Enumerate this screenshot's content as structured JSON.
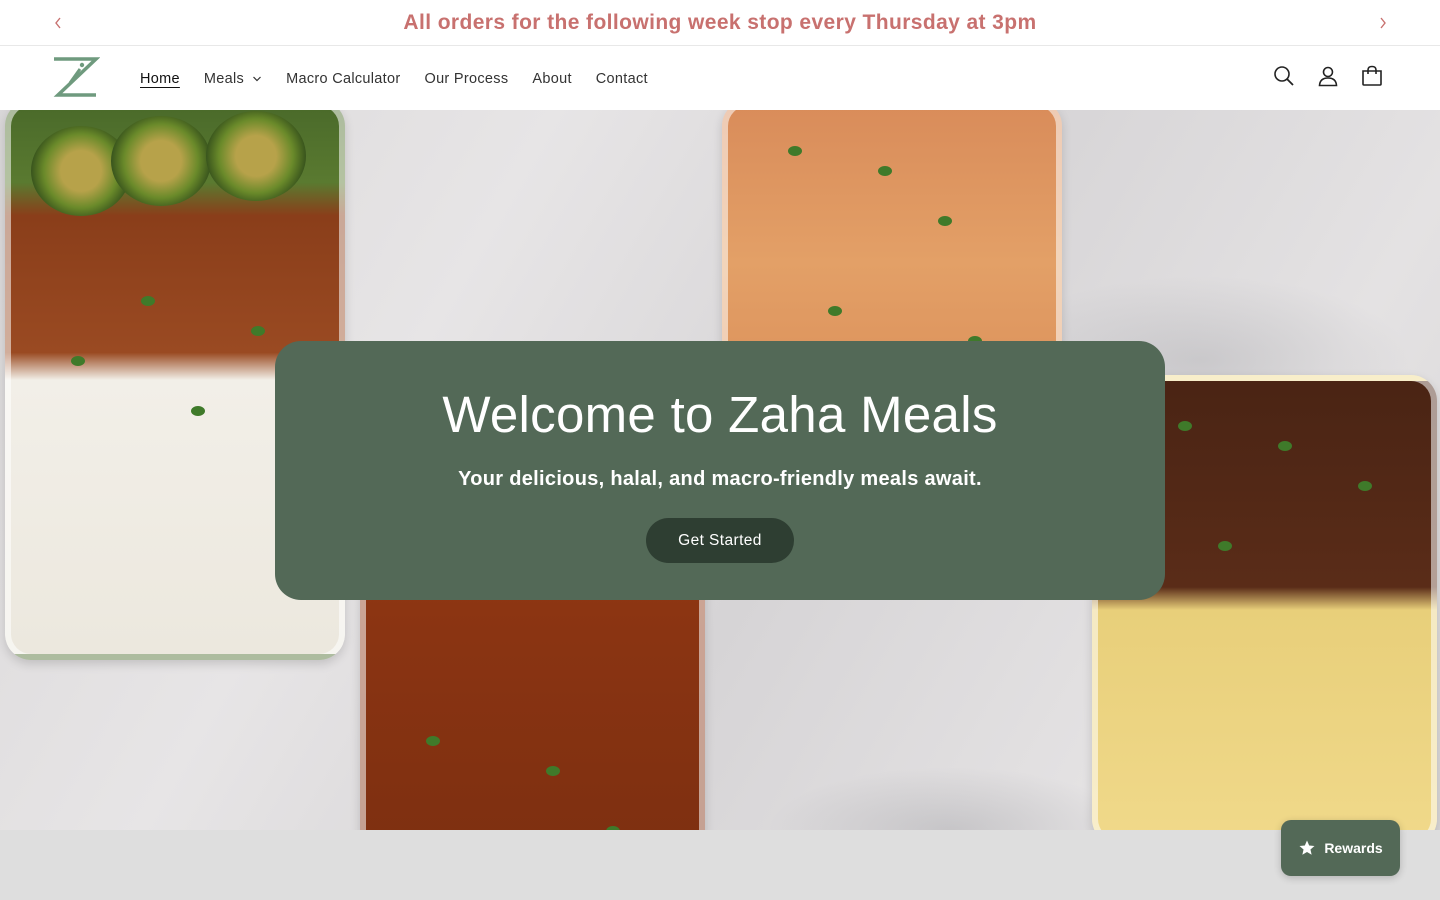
{
  "announcement": {
    "text": "All orders for the following week stop every Thursday at 3pm",
    "prev_icon": "chevron-left-icon",
    "next_icon": "chevron-right-icon"
  },
  "header": {
    "logo_icon": "zaha-logo-icon",
    "nav": [
      {
        "label": "Home",
        "active": true
      },
      {
        "label": "Meals",
        "has_dropdown": true
      },
      {
        "label": "Macro Calculator"
      },
      {
        "label": "Our Process"
      },
      {
        "label": "About"
      },
      {
        "label": "Contact"
      }
    ],
    "icons": [
      "search-icon",
      "account-icon",
      "cart-icon"
    ]
  },
  "hero": {
    "title": "Welcome to Zaha Meals",
    "subtitle": "Your delicious, halal, and macro-friendly meals await.",
    "button_label": "Get Started"
  },
  "rewards": {
    "label": "Rewards",
    "icon": "star-icon"
  },
  "colors": {
    "announcement_text": "#c8716f",
    "brand_green": "#536957",
    "button_dark": "#2e3e32"
  }
}
